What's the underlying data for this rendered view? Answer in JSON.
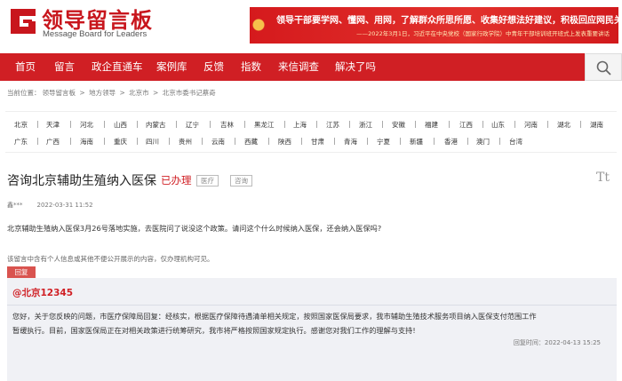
{
  "header": {
    "logo_title": "领导留言板",
    "logo_subtitle": "Message Board for Leaders",
    "banner_line1": "领导干部要学网、懂网、用网，了解群众所思所愿、收集好想法好建议，积极回应网民关切。",
    "banner_line2": "——2022年3月1日，习近平在中央党校（国家行政学院）中青年干部培训班开班式上发表重要讲话",
    "brand_color": "#d01f24"
  },
  "nav": {
    "items": [
      "首页",
      "留言",
      "政企直通车",
      "案例库",
      "反馈",
      "指数",
      "来信调查",
      "解决了吗"
    ]
  },
  "breadcrumb": {
    "prefix": "当前位置：",
    "items": [
      "领导留言板",
      "地方领导",
      "北京市",
      "北京市委书记蔡奇"
    ],
    "separator": ">"
  },
  "regions": {
    "row1": [
      "北京",
      "天津",
      "河北",
      "山西",
      "内蒙古",
      "辽宁",
      "吉林",
      "黑龙江",
      "上海",
      "江苏",
      "浙江",
      "安徽",
      "福建",
      "江西",
      "山东",
      "河南",
      "湖北",
      "湖南"
    ],
    "row2": [
      "广东",
      "广西",
      "海南",
      "重庆",
      "四川",
      "贵州",
      "云南",
      "西藏",
      "陕西",
      "甘肃",
      "青海",
      "宁夏",
      "新疆",
      "香港",
      "澳门",
      "台湾"
    ]
  },
  "message": {
    "title": "咨询北京辅助生殖纳入医保",
    "status": "已办理",
    "tags": [
      "医疗",
      "咨询"
    ],
    "font_icon": "Tt",
    "author": "鑫***",
    "date": "2022-03-31 11:52",
    "content": "北京辅助生殖纳入医保3月26号落地实施，去医院问了说没这个政策。请问这个什么时候纳入医保，还会纳入医保吗?",
    "privacy_note": "该留言中含有个人信息或其他不便公开展示的内容，仅办理机构可见。"
  },
  "reply": {
    "tab_label": "回复",
    "from": "@北京12345",
    "lines": [
      "您好，关于您反映的问题，市医疗保障局回复：经核实，根据医疗保障待遇清单相关规定，按照国家医保局要求，我市辅助生殖技术服务项目纳入医保支付范围工作",
      "暂缓执行。目前，国家医保局正在对相关政策进行统筹研究，我市将严格按照国家规定执行。感谢您对我们工作的理解与支持!"
    ],
    "time_label": "回复时间：",
    "time": "2022-04-13 15:25"
  }
}
